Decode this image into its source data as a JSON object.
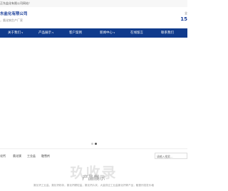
{
  "topbar": {
    "text": "正东盐化有限公司网站！"
  },
  "header": {
    "company_name": "东盐化有限公司",
    "slogan": "，氯化钠生产厂家",
    "hotline_label": "全",
    "hotline_number": "15"
  },
  "nav": {
    "items": [
      {
        "label": "关于我们",
        "has_dropdown": true
      },
      {
        "label": "产品展示",
        "has_dropdown": true
      },
      {
        "label": "客户案例",
        "has_dropdown": false
      },
      {
        "label": "新闻中心",
        "has_dropdown": true
      },
      {
        "label": "在线留言",
        "has_dropdown": false
      },
      {
        "label": "联系我们",
        "has_dropdown": false
      }
    ],
    "dropdown_arrow": "∨"
  },
  "carousel": {
    "total_slides": 2,
    "active_slide": 2
  },
  "quick_links": [
    "化钙",
    "氯化镁",
    "工业盐",
    "融雪剂"
  ],
  "search": {
    "placeholder": "请输入搜索..."
  },
  "section": {
    "title": "产品展示",
    "subtitle": "氯化钙工业盐，氯化钙粉状，氯化钙颗粒盐，氯化钙片状，大量供应工业盐氯化钙等产品，融雪剂批发价格"
  },
  "watermark": "玖收录",
  "colors": {
    "nav_bg": "#103b8c",
    "brand_blue": "#1a3f9a",
    "dot_active": "#555555",
    "dot_inactive": "#cccccc"
  }
}
